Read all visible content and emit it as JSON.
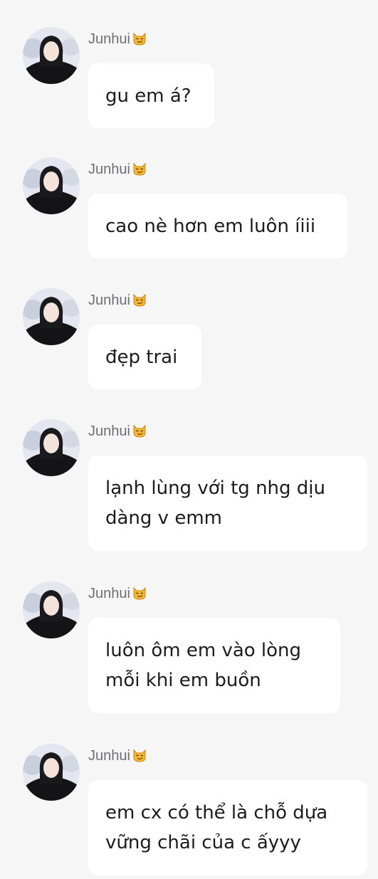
{
  "chat": {
    "messages": [
      {
        "sender": "Junhui",
        "text": "gu em á?"
      },
      {
        "sender": "Junhui",
        "text": "cao nè hơn em luôn íiii"
      },
      {
        "sender": "Junhui",
        "text": "đẹp trai"
      },
      {
        "sender": "Junhui",
        "text": "lạnh lùng với tg nhg dịu dàng v emm"
      },
      {
        "sender": "Junhui",
        "text": "luôn ôm em vào lòng mỗi khi em buồn"
      },
      {
        "sender": "Junhui",
        "text": "em cx có thể là chỗ dựa vững chãi của c ấyyy"
      }
    ],
    "sender_emoji_icon": "smirking-cat-emoji-icon",
    "colors": {
      "background": "#f6f6f7",
      "bubble": "#ffffff",
      "text": "#1c1c1e",
      "sender_name": "#6f6f73"
    }
  }
}
